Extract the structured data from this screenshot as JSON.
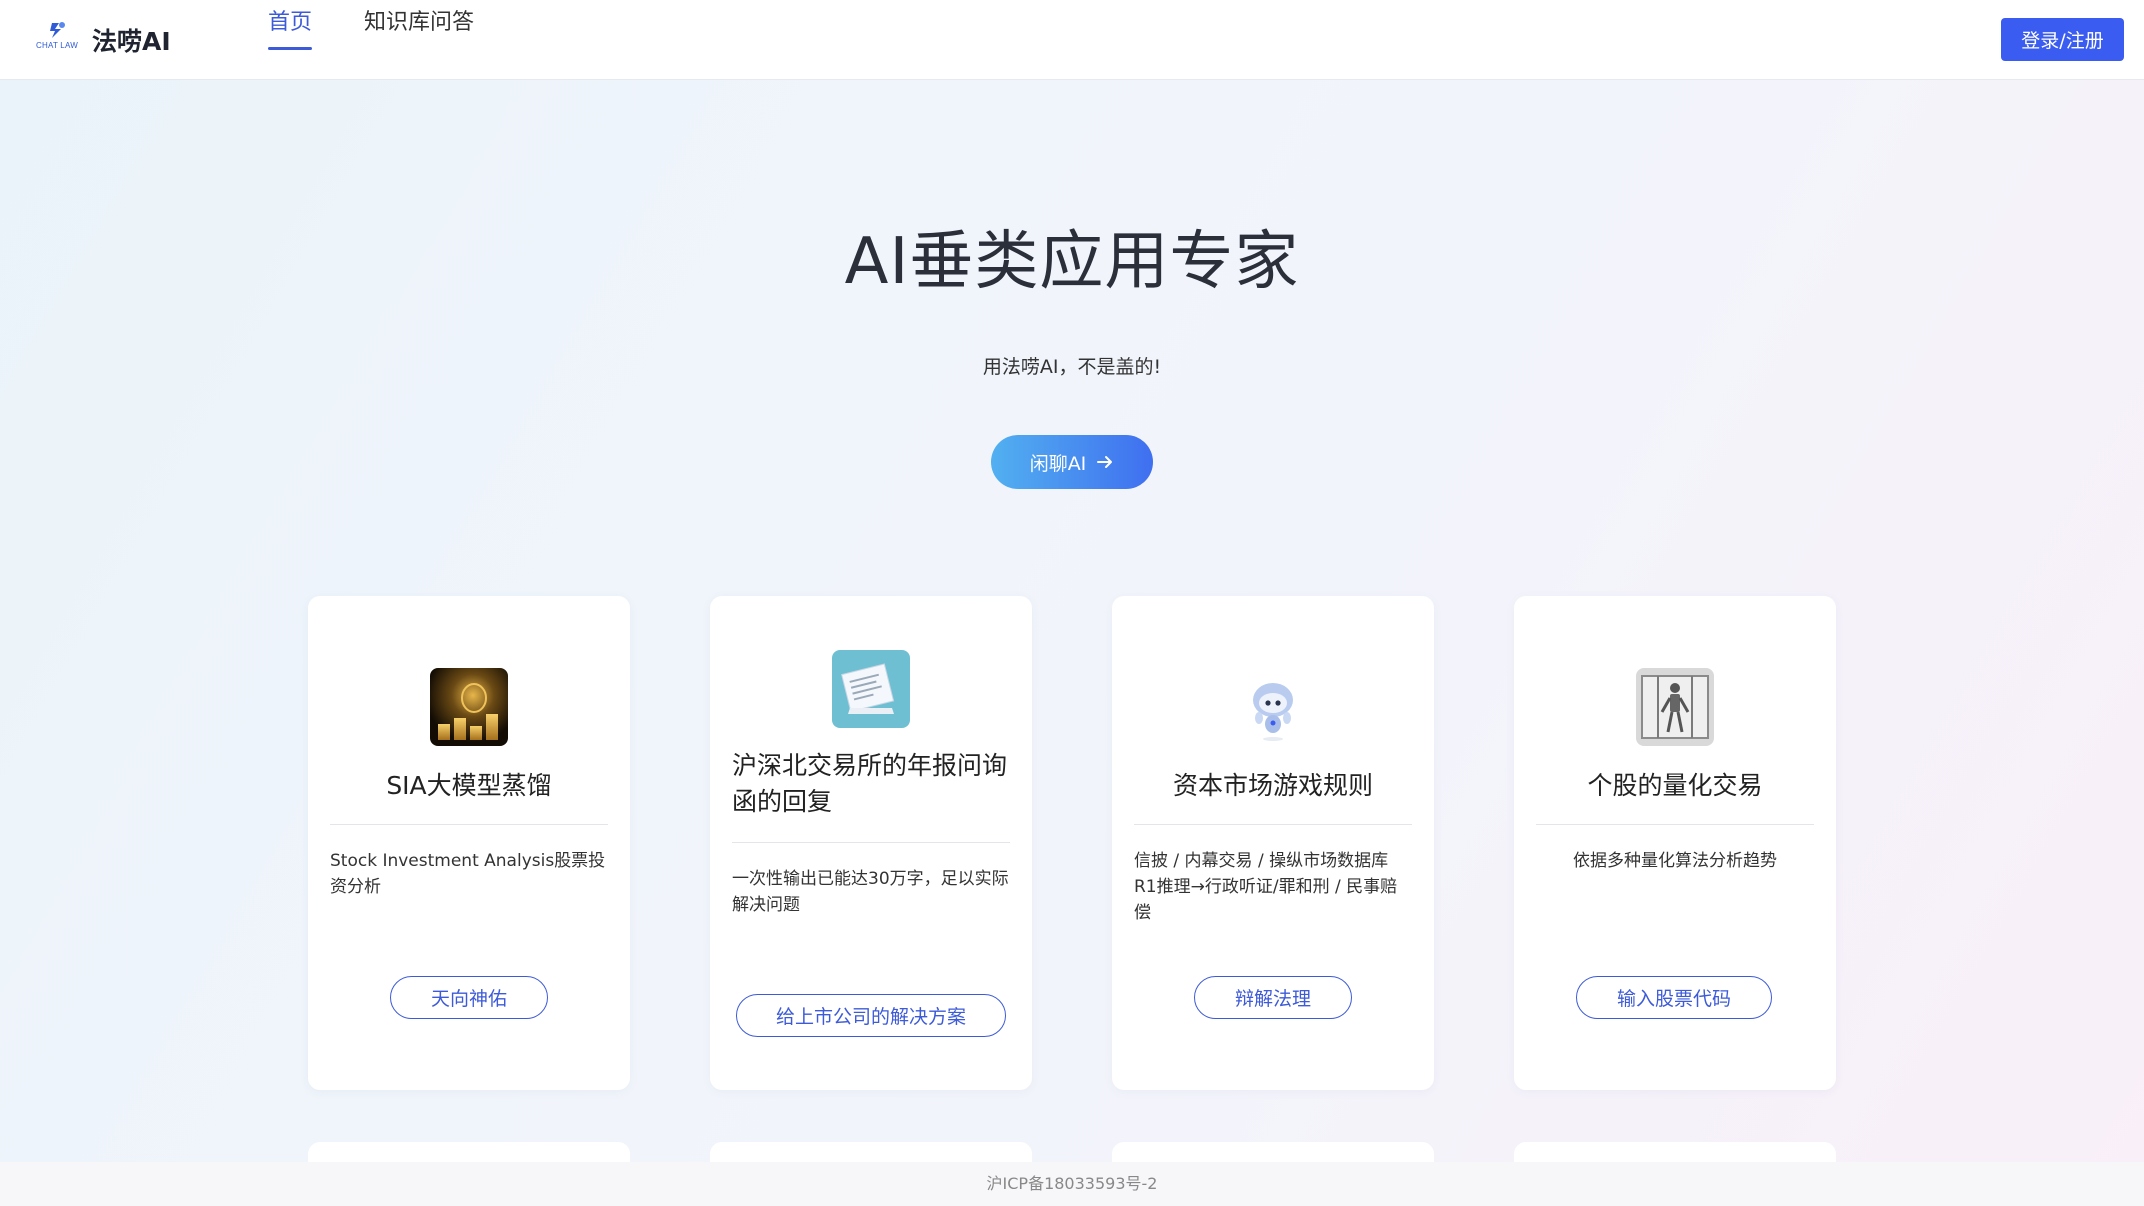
{
  "header": {
    "logo_text": "CHAT LAW",
    "brand": "法唠AI",
    "tabs": [
      {
        "label": "首页",
        "active": true
      },
      {
        "label": "知识库问答",
        "active": false
      }
    ],
    "login_label": "登录/注册"
  },
  "hero": {
    "title": "AI垂类应用专家",
    "subtitle": "用法唠AI，不是盖的!",
    "cta_label": "闲聊AI"
  },
  "cards": [
    {
      "title": "SIA大模型蒸馏",
      "description": "Stock Investment Analysis股票投资分析",
      "button": "天向神佑",
      "icon": "gold-coins-icon"
    },
    {
      "title": "沪深北交易所的年报问询函的回复",
      "description": "一次性输出已能达30万字，足以实际解决问题",
      "button": "给上市公司的解决方案",
      "icon": "document-letter-icon"
    },
    {
      "title": "资本市场游戏规则",
      "description": "信披 / 内幕交易 / 操纵市场数据库 R1推理→行政听证/罪和刑 / 民事赔偿",
      "button": "辩解法理",
      "icon": "robot-mascot-icon"
    },
    {
      "title": "个股的量化交易",
      "description": "依据多种量化算法分析趋势",
      "button": "输入股票代码",
      "icon": "robot-skeleton-icon"
    }
  ],
  "footer": {
    "icp": "沪ICP备18033593号-2"
  },
  "colors": {
    "accent": "#3b5cf0",
    "gradient_start": "#52b0f0",
    "gradient_end": "#3f6ff0"
  }
}
